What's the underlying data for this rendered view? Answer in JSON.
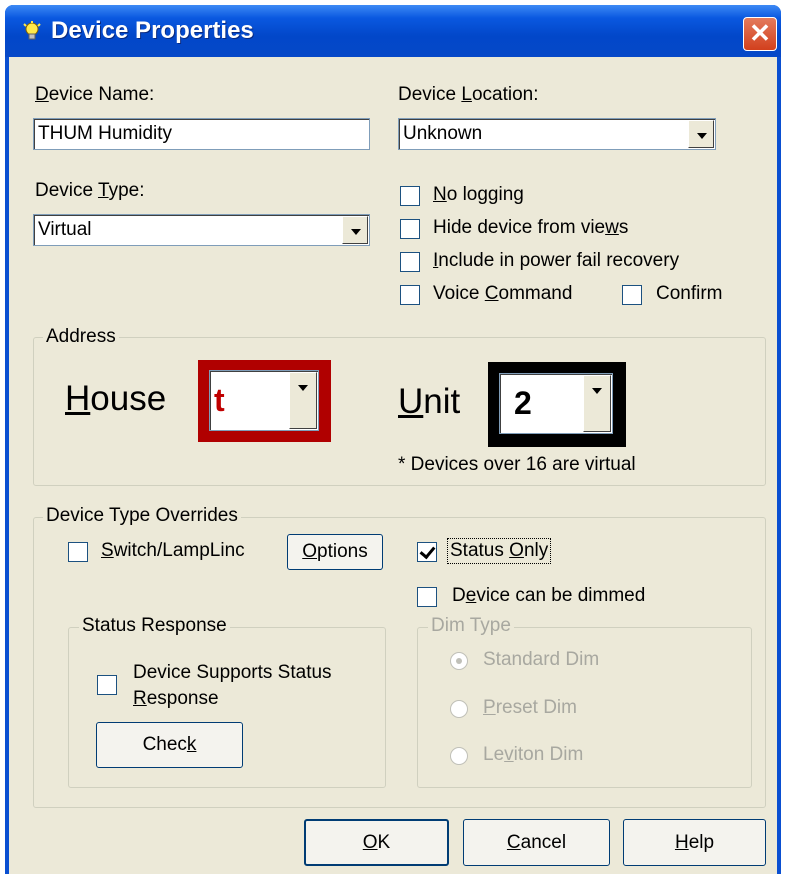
{
  "window": {
    "title": "Device Properties",
    "close_glyph": "✕",
    "title_icon": "lightbulb-icon"
  },
  "device_name": {
    "label_u": "D",
    "label_rest": "evice Name:",
    "value": "THUM Humidity"
  },
  "device_location": {
    "label_pre": "Device ",
    "label_u": "L",
    "label_rest": "ocation:",
    "value": "Unknown"
  },
  "device_type": {
    "label_pre": "Device ",
    "label_u": "T",
    "label_rest": "ype:",
    "value": "Virtual"
  },
  "options": {
    "no_logging": {
      "u": "N",
      "rest": "o logging",
      "checked": false
    },
    "hide_device": {
      "pre": "Hide device from vie",
      "u": "w",
      "rest": "s",
      "checked": false
    },
    "power_fail": {
      "u": "I",
      "rest": "nclude in power fail recovery",
      "checked": false
    },
    "voice_command": {
      "pre": "Voice ",
      "u": "C",
      "rest": "ommand",
      "checked": false
    },
    "confirm": {
      "label": "Confirm",
      "checked": false
    }
  },
  "address": {
    "group_title": "Address",
    "house_label_u": "H",
    "house_label_rest": "ouse",
    "house_value": "t",
    "unit_label_u": "U",
    "unit_label_rest": "nit",
    "unit_value": "2",
    "note": "* Devices over 16 are virtual",
    "house_highlight_color": "#b00000",
    "unit_highlight_color": "#000000"
  },
  "overrides": {
    "group_title": "Device Type Overrides",
    "switch_lamplinc": {
      "u": "S",
      "rest": "witch/LampLinc",
      "checked": false
    },
    "options_button": {
      "u": "O",
      "rest": "ptions"
    },
    "status_only": {
      "pre": "Status ",
      "u": "O",
      "rest": "nly",
      "checked": true
    },
    "can_be_dimmed": {
      "pre": "D",
      "u": "e",
      "rest": "vice can be dimmed",
      "checked": false
    },
    "status_response": {
      "group_title": "Status Response",
      "supports_line1": "Device Supports Status",
      "supports_u": "R",
      "supports_rest": "esponse",
      "checked": false,
      "check_button_pre": "Chec",
      "check_button_u": "k"
    },
    "dim_type": {
      "group_title": "Dim Type",
      "standard": {
        "label": "Standard Dim",
        "selected": true
      },
      "preset": {
        "u": "P",
        "rest": "reset Dim",
        "selected": false
      },
      "leviton": {
        "pre": "Le",
        "u": "v",
        "rest": "iton Dim",
        "selected": false
      }
    }
  },
  "buttons": {
    "ok": {
      "u": "O",
      "rest": "K"
    },
    "cancel": {
      "pre": "",
      "u": "C",
      "rest": "ancel"
    },
    "help": {
      "u": "H",
      "rest": "elp"
    }
  }
}
